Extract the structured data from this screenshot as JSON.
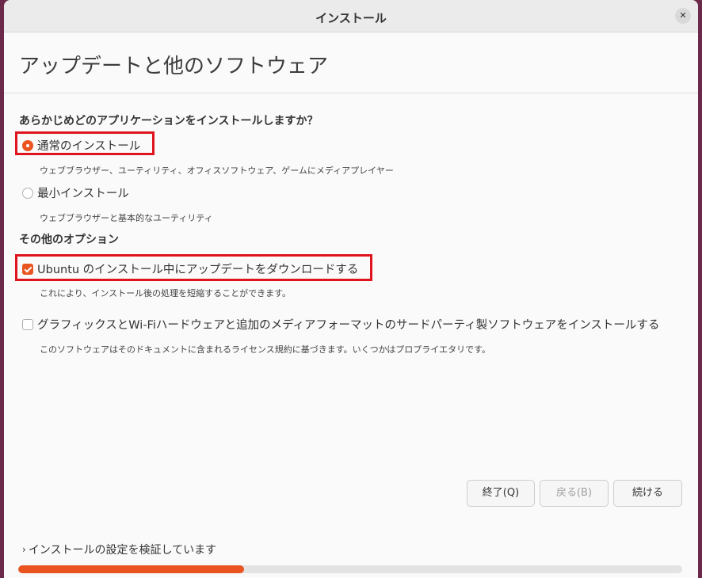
{
  "window": {
    "title": "インストール"
  },
  "header": {
    "title": "アップデートと他のソフトウェア"
  },
  "install_type": {
    "question": "あらかじめどのアプリケーションをインストールしますか？",
    "normal_label": "通常のインストール",
    "normal_desc": "ウェブブラウザー、ユーティリティ、オフィスソフトウェア、ゲームにメディアプレイヤー",
    "minimal_label": "最小インストール",
    "minimal_desc": "ウェブブラウザーと基本的なユーティリティ",
    "selected": "normal"
  },
  "other_options": {
    "heading": "その他のオプション",
    "download_updates_label": "Ubuntu のインストール中にアップデートをダウンロードする",
    "download_updates_desc": "これにより、インストール後の処理を短縮することができます。",
    "download_updates_checked": true,
    "third_party_label": "グラフィックスとWi-Fiハードウェアと追加のメディアフォーマットのサードパーティ製ソフトウェアをインストールする",
    "third_party_desc": "このソフトウェアはそのドキュメントに含まれるライセンス規約に基づきます。いくつかはプロプライエタリです。",
    "third_party_checked": false
  },
  "buttons": {
    "quit": "終了(Q)",
    "back": "戻る(B)",
    "continue": "続ける"
  },
  "status": {
    "text": "インストールの設定を検証しています",
    "progress": 0.34
  },
  "colors": {
    "accent": "#e95420",
    "highlight": "#e0141e"
  }
}
